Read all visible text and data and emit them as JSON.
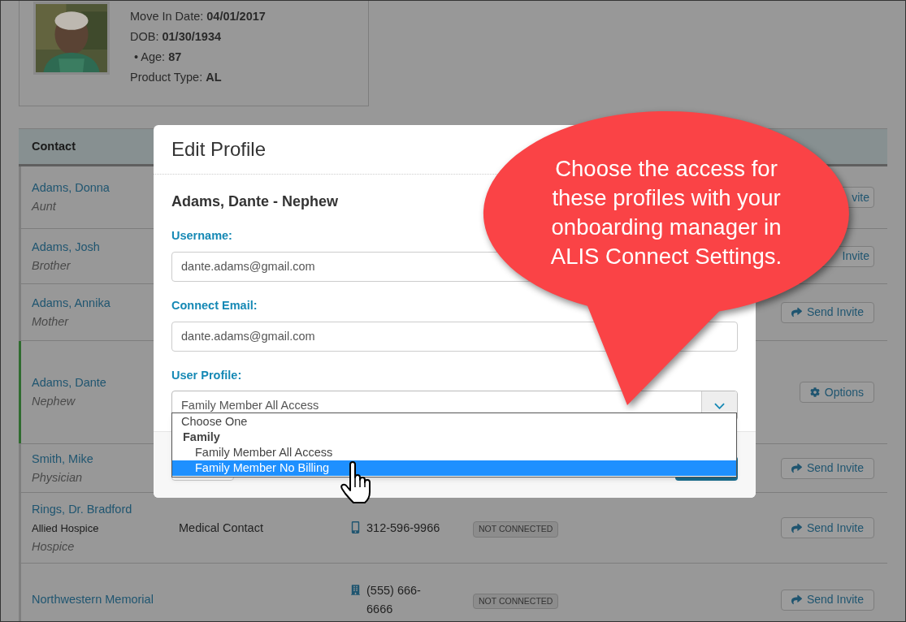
{
  "resident": {
    "fields": [
      {
        "label": "Move In Date:",
        "value": "04/01/2017",
        "kind": "plain"
      },
      {
        "label": "DOB:",
        "value": "01/30/1934",
        "kind": "plain"
      },
      {
        "label": "Age:",
        "value": "87",
        "kind": "bullet",
        "marker": "•"
      },
      {
        "label": "Product Type:",
        "value": "AL",
        "kind": "plain"
      }
    ]
  },
  "contacts_table": {
    "columns": [
      "Contact"
    ],
    "rows": [
      {
        "name": "Adams, Donna",
        "relation": "Aunt",
        "selected": false,
        "action": {
          "label": "vite",
          "kind": "partial"
        }
      },
      {
        "name": "Adams, Josh",
        "relation": "Brother",
        "selected": false,
        "action": {
          "label": "Invite",
          "kind": "partial"
        }
      },
      {
        "name": "Adams, Annika",
        "relation": "Mother",
        "selected": false,
        "action": {
          "label": "Send Invite",
          "kind": "invite"
        }
      },
      {
        "name": "Adams, Dante",
        "relation": "Nephew",
        "selected": true,
        "action": {
          "label": "Options",
          "kind": "options"
        }
      },
      {
        "name": "Smith, Mike",
        "relation": "Physician",
        "selected": false,
        "action": {
          "label": "Send Invite",
          "kind": "invite"
        }
      },
      {
        "name": "Rings, Dr. Bradford",
        "organization": "Allied Hospice",
        "relation": "Hospice",
        "role": "Medical Contact",
        "phone": {
          "number": "312-596-9966",
          "kind": "mobile"
        },
        "status": "NOT CONNECTED",
        "selected": false,
        "action": {
          "label": "Send Invite",
          "kind": "invite"
        }
      },
      {
        "name": "Northwestern Memorial",
        "phone": {
          "number": "(555) 666-6666",
          "kind": "office"
        },
        "status": "NOT CONNECTED",
        "selected": false,
        "action": {
          "label": "Send Invite",
          "kind": "invite"
        }
      }
    ]
  },
  "modal": {
    "title": "Edit Profile",
    "subtitle": "Adams, Dante - Nephew",
    "fields": [
      {
        "label": "Username:",
        "value": "dante.adams@gmail.com",
        "kind": "text"
      },
      {
        "label": "Connect Email:",
        "value": "dante.adams@gmail.com",
        "kind": "text"
      },
      {
        "label": "User Profile:",
        "value": "Family Member All Access",
        "kind": "select"
      }
    ],
    "dropdown": {
      "options": [
        {
          "label": "Choose One",
          "kind": "option",
          "selected": false
        },
        {
          "label": "Family",
          "kind": "group",
          "selected": false
        },
        {
          "label": "Family Member All Access",
          "kind": "suboption",
          "selected": false
        },
        {
          "label": "Family Member No Billing",
          "kind": "suboption",
          "selected": true
        }
      ]
    }
  },
  "callout": {
    "lines": [
      "Choose the access for",
      "these profiles with your",
      "onboarding manager in",
      "ALIS Connect Settings."
    ]
  }
}
